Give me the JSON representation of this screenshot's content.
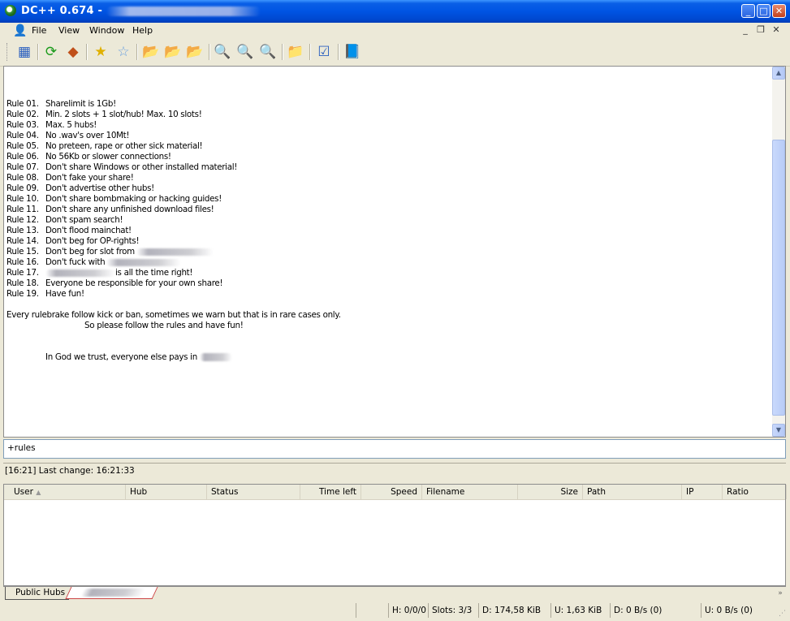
{
  "window": {
    "title": "DC++ 0.674 -",
    "title_blurred": "hub name (blurred)"
  },
  "menu": [
    "File",
    "View",
    "Window",
    "Help"
  ],
  "toolbar_icons": [
    "favorites-users-icon",
    "reconnect-icon",
    "follow-redirect-icon",
    "favorite-hubs-icon",
    "favorite-users-icon",
    "download-queue-icon",
    "finished-downloads-icon",
    "finished-uploads-icon",
    "search-icon",
    "adl-search-icon",
    "search-spy-icon",
    "open-file-list-icon",
    "settings-icon",
    "notepad-icon"
  ],
  "chat": {
    "rules": [
      {
        "n": "Rule 01.",
        "t": "Sharelimit is 1Gb!"
      },
      {
        "n": "Rule 02.",
        "t": "Min. 2 slots + 1 slot/hub! Max. 10 slots!"
      },
      {
        "n": "Rule 03.",
        "t": "Max. 5 hubs!"
      },
      {
        "n": "Rule 04.",
        "t": "No .wav's over 10Mt!"
      },
      {
        "n": "Rule 05.",
        "t": "No preteen, rape or other sick material!"
      },
      {
        "n": "Rule 06.",
        "t": "No 56Kb or slower connections!"
      },
      {
        "n": "Rule 07.",
        "t": "Don't share Windows or other installed material!"
      },
      {
        "n": "Rule 08.",
        "t": "Don't fake your share!"
      },
      {
        "n": "Rule 09.",
        "t": "Don't advertise other hubs!"
      },
      {
        "n": "Rule 10.",
        "t": "Don't share bombmaking or hacking guides!"
      },
      {
        "n": "Rule 11.",
        "t": "Don't share any unfinished download files!"
      },
      {
        "n": "Rule 12.",
        "t": "Don't spam search!"
      },
      {
        "n": "Rule 13.",
        "t": "Don't flood mainchat!"
      },
      {
        "n": "Rule 14.",
        "t": "Don't beg for OP-rights!"
      },
      {
        "n": "Rule 15.",
        "t": "Don't beg for slot from"
      },
      {
        "n": "Rule 16.",
        "t": "Don't fuck with"
      },
      {
        "n": "Rule 17.",
        "t": "is all the time right!"
      },
      {
        "n": "Rule 18.",
        "t": "Everyone be responsible for your own share!"
      },
      {
        "n": "Rule 19.",
        "t": "Have fun!"
      }
    ],
    "footer1": "Every rulebrake follow kick or ban, sometimes we warn but that is in rare cases only.",
    "footer2": "So please follow the rules and have fun!",
    "footer3": "In God we trust, everyone else pays in"
  },
  "input_value": "+rules",
  "status_line": "[16:21] Last change: 16:21:33",
  "transfers": {
    "columns": [
      "User",
      "Hub",
      "Status",
      "Time left",
      "Speed",
      "Filename",
      "Size",
      "Path",
      "IP",
      "Ratio"
    ]
  },
  "tabs": {
    "public_hubs": "Public Hubs"
  },
  "statusbar": {
    "hubs": "H: 0/0/0",
    "slots": "Slots: 3/3",
    "downloaded": "D: 174,58 KiB",
    "uploaded": "U: 1,63 KiB",
    "down_rate": "D: 0 B/s (0)",
    "up_rate": "U: 0 B/s (0)"
  }
}
